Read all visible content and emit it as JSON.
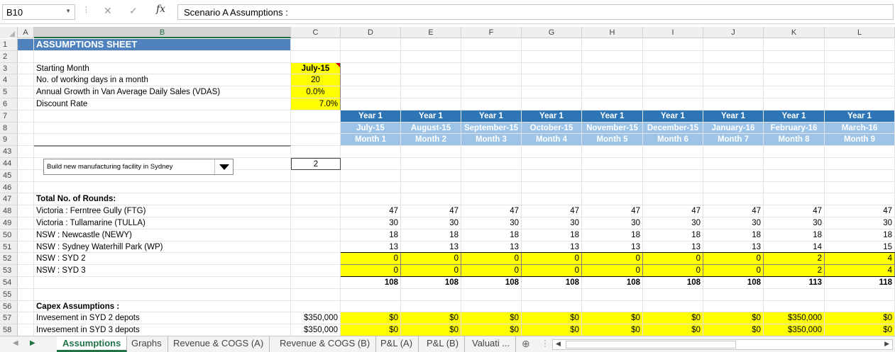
{
  "formula_bar": {
    "name_box": "B10",
    "fx": "fx",
    "content": "Scenario A Assumptions :"
  },
  "columns": [
    "A",
    "B",
    "C",
    "D",
    "E",
    "F",
    "G",
    "H",
    "I",
    "J",
    "K",
    "L"
  ],
  "selected_column": "B",
  "rows": [
    "1",
    "2",
    "3",
    "4",
    "5",
    "6",
    "7",
    "8",
    "9",
    "43",
    "44",
    "45",
    "46",
    "47",
    "48",
    "49",
    "50",
    "51",
    "52",
    "53",
    "54",
    "55",
    "56",
    "57",
    "58"
  ],
  "title": "ASSUMPTIONS SHEET",
  "params": [
    {
      "label": "Starting Month",
      "value": "July-15"
    },
    {
      "label": "No. of working days in a month",
      "value": "20"
    },
    {
      "label": "Annual Growth in Van Average Daily Sales  (VDAS)",
      "value": "0.0%"
    },
    {
      "label": "Discount Rate",
      "value": "7.0%"
    }
  ],
  "month_headers": {
    "years": [
      "Year 1",
      "Year 1",
      "Year 1",
      "Year 1",
      "Year 1",
      "Year 1",
      "Year 1",
      "Year 1",
      "Year 1"
    ],
    "months": [
      "July-15",
      "August-15",
      "September-15",
      "October-15",
      "November-15",
      "December-15",
      "January-16",
      "February-16",
      "March-16"
    ],
    "month_nums": [
      "Month 1",
      "Month 2",
      "Month 3",
      "Month 4",
      "Month 5",
      "Month 6",
      "Month 7",
      "Month 8",
      "Month 9"
    ]
  },
  "dropdown": {
    "value": "Build new manufacturing facility in Sydney",
    "index": "2"
  },
  "rounds": {
    "heading": "Total No. of Rounds:",
    "items": [
      {
        "label": "Victoria : Ferntree Gully (FTG)",
        "values": [
          "47",
          "47",
          "47",
          "47",
          "47",
          "47",
          "47",
          "47",
          "47"
        ]
      },
      {
        "label": "Victoria : Tullamarine (TULLA)",
        "values": [
          "30",
          "30",
          "30",
          "30",
          "30",
          "30",
          "30",
          "30",
          "30"
        ]
      },
      {
        "label": "NSW : Newcastle (NEWY)",
        "values": [
          "18",
          "18",
          "18",
          "18",
          "18",
          "18",
          "18",
          "18",
          "18"
        ]
      },
      {
        "label": "NSW : Sydney Waterhill Park (WP)",
        "values": [
          "13",
          "13",
          "13",
          "13",
          "13",
          "13",
          "13",
          "14",
          "15"
        ]
      },
      {
        "label": "NSW : SYD 2",
        "values": [
          "0",
          "0",
          "0",
          "0",
          "0",
          "0",
          "0",
          "2",
          "4"
        ]
      },
      {
        "label": "NSW : SYD 3",
        "values": [
          "0",
          "0",
          "0",
          "0",
          "0",
          "0",
          "0",
          "2",
          "4"
        ]
      }
    ],
    "totals": [
      "108",
      "108",
      "108",
      "108",
      "108",
      "108",
      "108",
      "113",
      "118"
    ]
  },
  "capex": {
    "heading": "Capex Assumptions :",
    "items": [
      {
        "label": "Invesement in SYD 2 depots",
        "c_value": "$350,000",
        "values": [
          "$0",
          "$0",
          "$0",
          "$0",
          "$0",
          "$0",
          "$0",
          "$350,000",
          "$0"
        ]
      },
      {
        "label": "Invesement in SYD 3 depots",
        "c_value": "$350,000",
        "values": [
          "$0",
          "$0",
          "$0",
          "$0",
          "$0",
          "$0",
          "$0",
          "$350,000",
          "$0"
        ]
      }
    ]
  },
  "tabs": [
    "Assumptions",
    "Graphs",
    "Revenue & COGS (A)",
    "Revenue & COGS (B)",
    "P&L (A)",
    "P&L (B)",
    "Valuati ..."
  ],
  "active_tab": "Assumptions",
  "colors": {
    "excel_green": "#217346",
    "title_blue": "#4f81bd",
    "header_dark_blue": "#2e75b6",
    "header_light_blue": "#9dc3e6",
    "highlight_yellow": "#ffff00"
  }
}
